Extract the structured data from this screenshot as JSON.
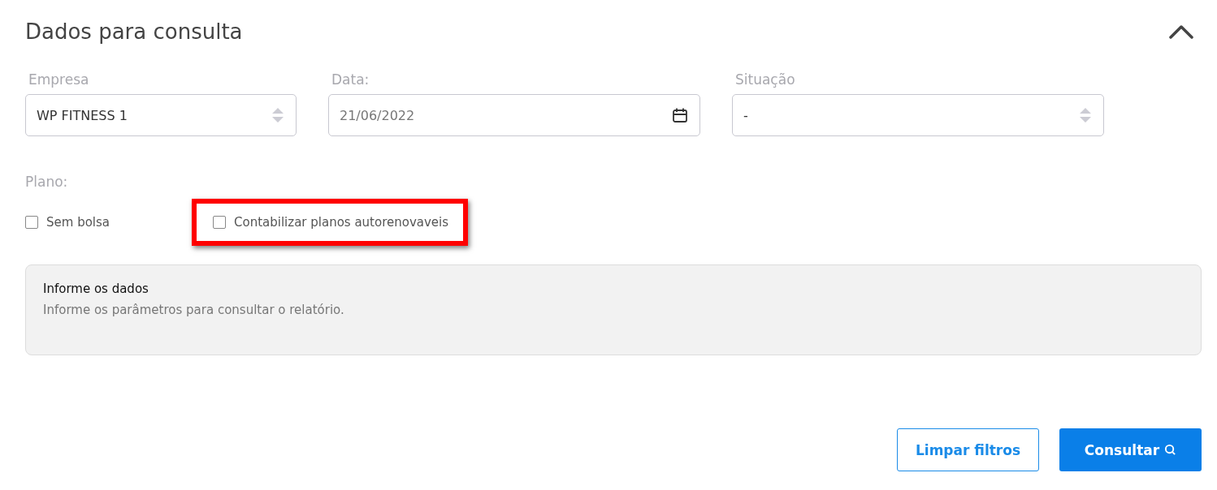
{
  "panel": {
    "title": "Dados para consulta",
    "expanded": true
  },
  "fields": [
    {
      "kind": "select",
      "label": "Empresa",
      "value": "WP FITNESS 1"
    },
    {
      "kind": "date",
      "label": "Data:",
      "value": "21/06/2022"
    },
    {
      "kind": "select",
      "label": "Situação",
      "value": "-"
    }
  ],
  "plano": {
    "label": "Plano:",
    "options": [
      {
        "label": "Sem bolsa",
        "checked": false,
        "highlighted": false
      },
      {
        "label": "Contabilizar planos autorenovaveis",
        "checked": false,
        "highlighted": true
      }
    ]
  },
  "info": {
    "title": "Informe os dados",
    "text": "Informe os parâmetros para consultar o relatório."
  },
  "buttons": [
    {
      "kind": "outline",
      "label": "Limpar filtros"
    },
    {
      "kind": "primary",
      "label": "Consultar"
    }
  ]
}
